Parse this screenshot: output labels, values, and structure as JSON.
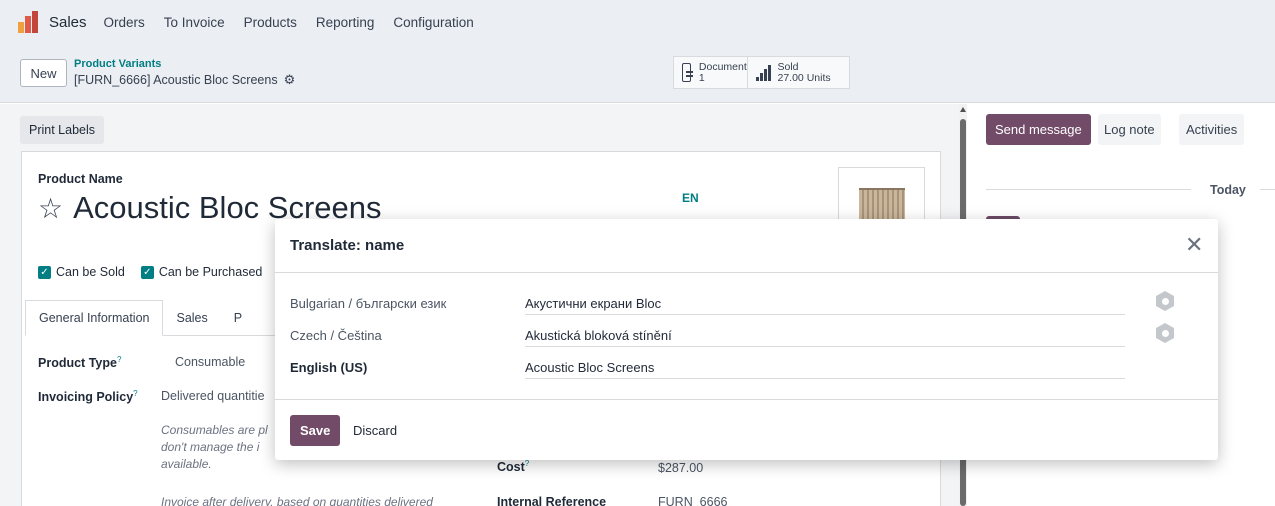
{
  "navbar": {
    "app_name": "Sales",
    "menu": [
      "Orders",
      "To Invoice",
      "Products",
      "Reporting",
      "Configuration"
    ]
  },
  "control_panel": {
    "new_label": "New",
    "breadcrumb_parent": "Product Variants",
    "breadcrumb_current": "[FURN_6666] Acoustic Bloc Screens",
    "smart_buttons": [
      {
        "icon": "document-icon",
        "label": "Documents",
        "value": "1"
      },
      {
        "icon": "bar-chart-icon",
        "label": "Sold",
        "value": "27.00 Units"
      }
    ]
  },
  "form": {
    "print_labels": "Print Labels",
    "product_name_label": "Product Name",
    "product_name": "Acoustic Bloc Screens",
    "lang_badge": "EN",
    "checkboxes": [
      "Can be Sold",
      "Can be Purchased"
    ],
    "tabs": [
      "General Information",
      "Sales",
      "P"
    ],
    "product_type_label": "Product Type",
    "product_type_value": "Consumable",
    "invoicing_policy_label": "Invoicing Policy",
    "invoicing_policy_value": "Delivered quantitie",
    "note_consumable": [
      "Consumables are pl",
      "don't manage the i",
      "available."
    ],
    "note_invoice": "Invoice after delivery, based on quantities delivered",
    "cost_label": "Cost",
    "cost_value": "$287.00",
    "internal_ref_label": "Internal Reference",
    "internal_ref_value": "FURN_6666"
  },
  "chatter": {
    "send_message": "Send message",
    "log_note": "Log note",
    "activities": "Activities",
    "today": "Today"
  },
  "dialog": {
    "title": "Translate: name",
    "rows": [
      {
        "lang": "Bulgarian / български език",
        "value": "Акустични екрани Bloc",
        "current": false
      },
      {
        "lang": "Czech / Čeština",
        "value": "Akustická bloková stínění",
        "current": false
      },
      {
        "lang": "English (US)",
        "value": "Acoustic Bloc Screens",
        "current": true
      }
    ],
    "save": "Save",
    "discard": "Discard"
  },
  "colors": {
    "primary": "#714b67",
    "accent": "#017e84"
  }
}
